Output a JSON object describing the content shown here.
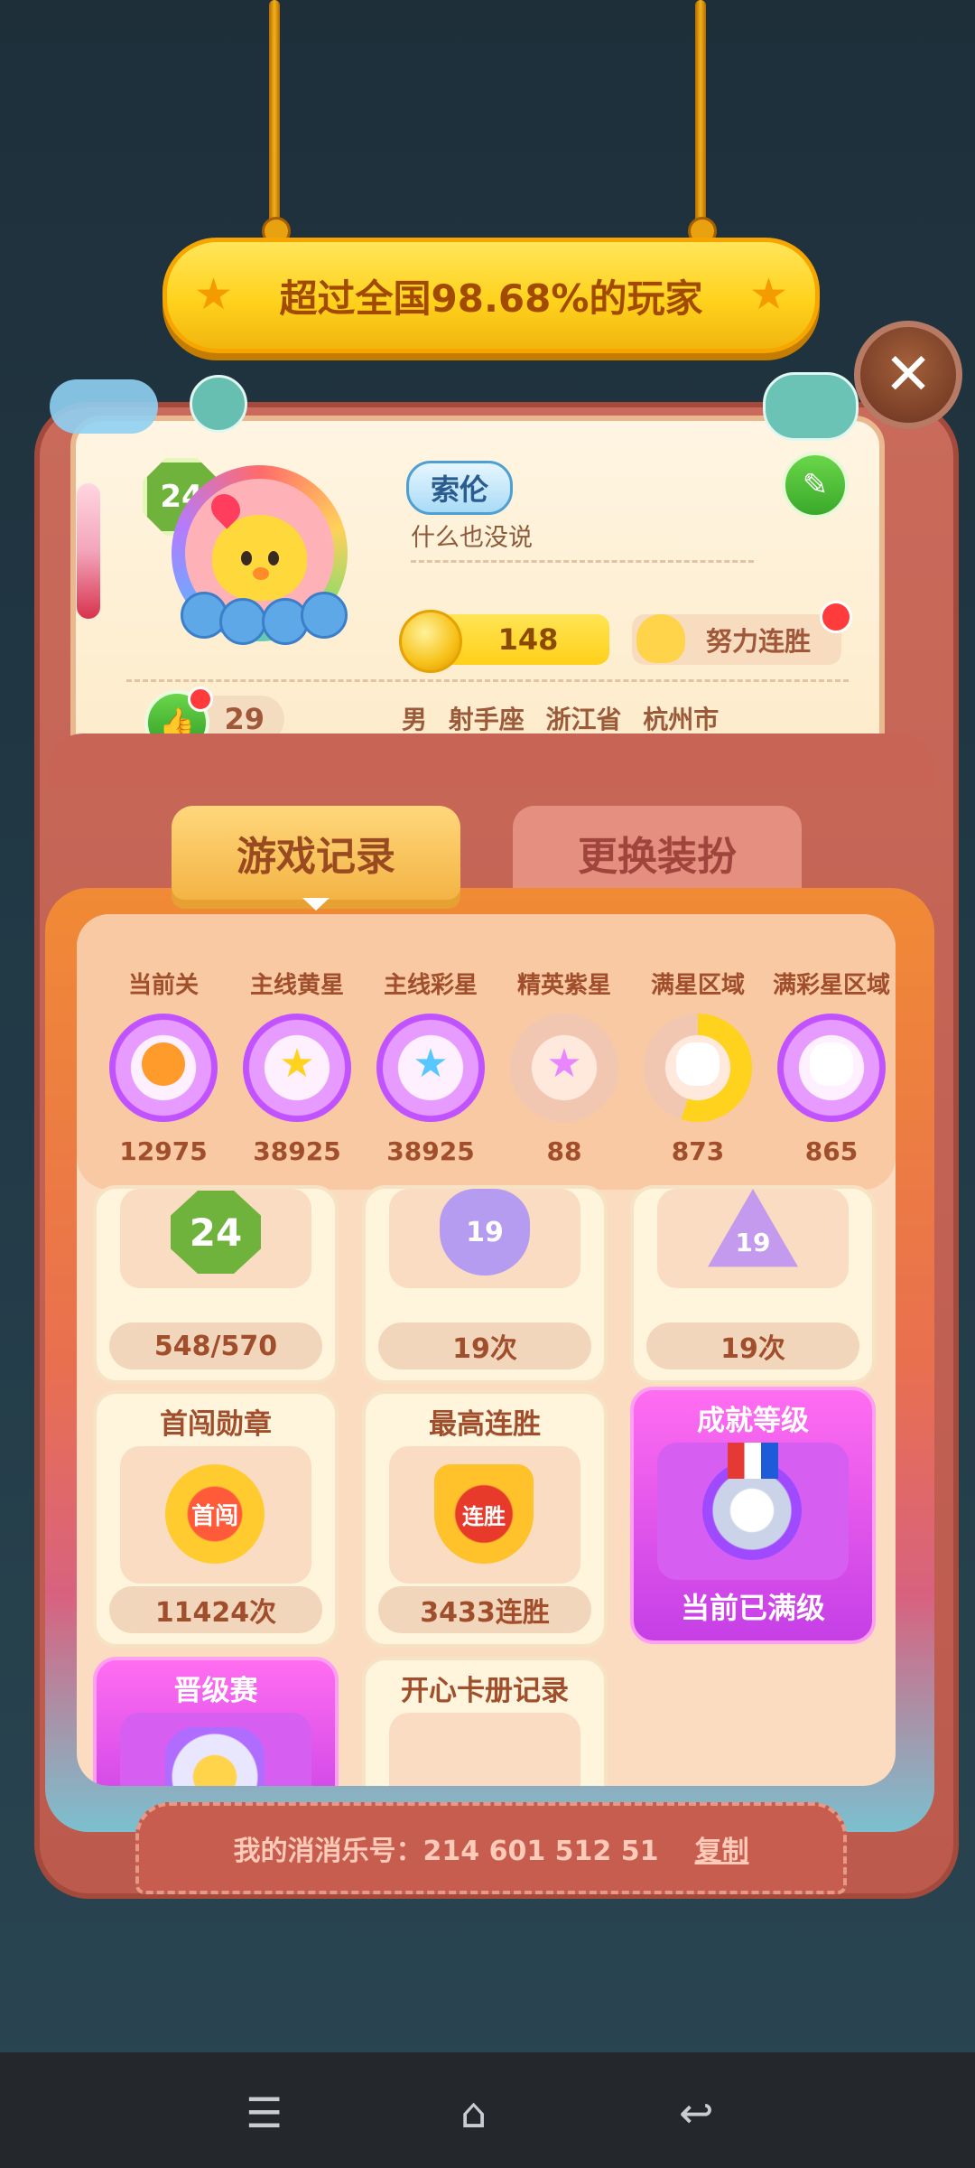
{
  "banner": {
    "text": "超过全国98.68%的玩家"
  },
  "profile": {
    "level": "24",
    "name": "索伦",
    "motto": "什么也没说",
    "coins": "148",
    "streak_label": "努力连胜",
    "likes": "29",
    "gender": "男",
    "zodiac": "射手座",
    "province": "浙江省",
    "city": "杭州市"
  },
  "tabs": {
    "records": "游戏记录",
    "outfit": "更换装扮"
  },
  "stats": [
    {
      "title": "当前关",
      "value": "12975",
      "icon": "carrot-icon"
    },
    {
      "title": "主线黄星",
      "value": "38925",
      "icon": "yellow-star-icon"
    },
    {
      "title": "主线彩星",
      "value": "38925",
      "icon": "rainbow-star-icon"
    },
    {
      "title": "精英紫星",
      "value": "88",
      "icon": "purple-star-icon"
    },
    {
      "title": "满星区域",
      "value": "873",
      "icon": "cloud-icon"
    },
    {
      "title": "满彩星区域",
      "value": "865",
      "icon": "rainbow-cloud-icon"
    }
  ],
  "cards_row1": [
    {
      "badge": "24",
      "foot": "548/570"
    },
    {
      "badge": "19",
      "foot": "19次"
    },
    {
      "badge": "19",
      "foot": "19次"
    }
  ],
  "cards_row2": [
    {
      "title": "首闯勋章",
      "badge": "首闯",
      "foot": "11424次"
    },
    {
      "title": "最高连胜",
      "badge": "连胜",
      "foot": "3433连胜"
    },
    {
      "title": "成就等级",
      "foot": "当前已满级"
    }
  ],
  "cards_row3": [
    {
      "title": "晋级赛"
    },
    {
      "title": "开心卡册记录"
    }
  ],
  "footer": {
    "label": "我的消消乐号：214 601 512 51",
    "copy": "复制"
  },
  "colors": {
    "accent": "#ffd21d",
    "frame": "#c96a5b",
    "purple_card": "#c53fe6"
  }
}
